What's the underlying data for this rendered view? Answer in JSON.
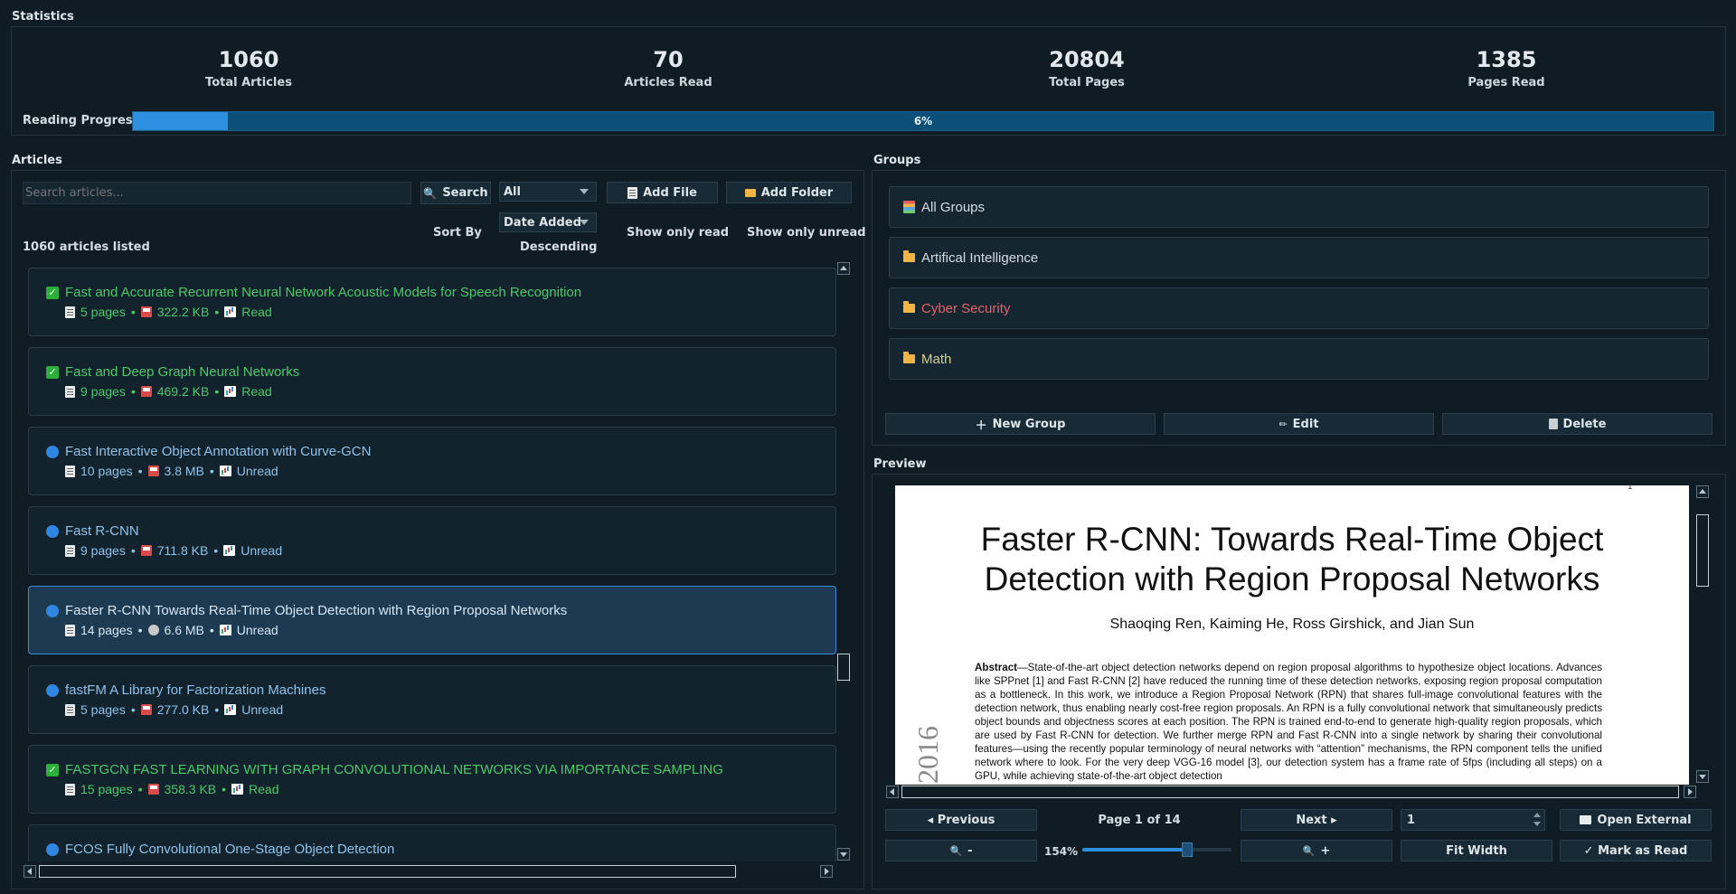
{
  "statistics": {
    "title": "Statistics",
    "total_articles": "1060",
    "total_articles_label": "Total Articles",
    "articles_read": "70",
    "articles_read_label": "Articles Read",
    "total_pages": "20804",
    "total_pages_label": "Total Pages",
    "pages_read": "1385",
    "pages_read_label": "Pages Read",
    "progress_label": "Reading Progress",
    "progress_text": "6%",
    "progress_fraction": 0.06
  },
  "articles": {
    "title": "Articles",
    "search_placeholder": "Search articles...",
    "search_button": "Search",
    "filter_value": "All",
    "add_file": "Add File",
    "add_folder": "Add Folder",
    "sort_by_label": "Sort By",
    "sort_value": "Date Added",
    "order_label": "Descending",
    "show_only_read": "Show only read",
    "show_only_unread": "Show only unread",
    "count_text": "1060 articles listed",
    "items": [
      {
        "title": "Fast and Accurate Recurrent Neural Network Acoustic Models for Speech Recognition",
        "pages": "5 pages",
        "size": "322.2 KB",
        "status": "Read",
        "read": true
      },
      {
        "title": "Fast and Deep Graph Neural Networks",
        "pages": "9 pages",
        "size": "469.2 KB",
        "status": "Read",
        "read": true
      },
      {
        "title": "Fast Interactive Object Annotation with Curve-GCN",
        "pages": "10 pages",
        "size": "3.8 MB",
        "status": "Unread",
        "read": false
      },
      {
        "title": "Fast R-CNN",
        "pages": "9 pages",
        "size": "711.8 KB",
        "status": "Unread",
        "read": false
      },
      {
        "title": "Faster R-CNN Towards Real-Time Object Detection with Region Proposal Networks",
        "pages": "14 pages",
        "size": "6.6 MB",
        "status": "Unread",
        "read": false,
        "selected": true
      },
      {
        "title": "fastFM A Library for Factorization Machines",
        "pages": "5 pages",
        "size": "277.0 KB",
        "status": "Unread",
        "read": false
      },
      {
        "title": "FASTGCN FAST LEARNING WITH GRAPH CONVOLUTIONAL NETWORKS VIA IMPORTANCE SAMPLING",
        "pages": "15 pages",
        "size": "358.3 KB",
        "status": "Read",
        "read": true
      },
      {
        "title": "FCOS Fully Convolutional One-Stage Object Detection",
        "pages": "",
        "size": "",
        "status": "",
        "read": false
      }
    ]
  },
  "groups": {
    "title": "Groups",
    "items": [
      {
        "label": "All Groups",
        "color": "#cfd7dc"
      },
      {
        "label": "Artifical Intelligence",
        "color": "#cfd7dc"
      },
      {
        "label": "Cyber Security",
        "color": "#e0646a"
      },
      {
        "label": "Math",
        "color": "#d7d08e"
      }
    ],
    "new_group": "New Group",
    "edit": "Edit",
    "delete": "Delete"
  },
  "preview": {
    "title": "Preview",
    "paper_title_line1": "Faster R-CNN: Towards Real-Time Object",
    "paper_title_line2": "Detection with Region Proposal Networks",
    "authors": "Shaoqing Ren, Kaiming He, Ross Girshick, and Jian Sun",
    "abstract_label": "Abstract",
    "abstract_text": "—State-of-the-art object detection networks depend on region proposal algorithms to hypothesize object locations. Advances like SPPnet [1] and Fast R-CNN [2] have reduced the running time of these detection networks, exposing region proposal computation as a bottleneck. In this work, we introduce a Region Proposal Network (RPN) that shares full-image convolutional features with the detection network, thus enabling nearly cost-free region proposals. An RPN is a fully convolutional network that simultaneously predicts object bounds and objectness scores at each position. The RPN is trained end-to-end to generate high-quality region proposals, which are used by Fast R-CNN for detection. We further merge RPN and Fast R-CNN into a single network by sharing their convolutional features—using the recently popular terminology of neural networks with “attention” mechanisms, the RPN component tells the unified network where to look. For the very deep VGG-16 model [3], our detection system has a frame rate of 5fps (including all steps) on a GPU, while achieving state-of-the-art object detection",
    "side_year": "2016",
    "page_mark": "1",
    "previous": "◂ Previous",
    "page_indicator": "Page 1 of 14",
    "next": "Next ▸",
    "page_input": "1",
    "open_external": "Open External",
    "zoom_out": "-",
    "zoom_level": "154%",
    "zoom_fraction": 0.7,
    "zoom_in": "+",
    "fit_width": "Fit Width",
    "mark_as_read": "✓ Mark as Read"
  }
}
